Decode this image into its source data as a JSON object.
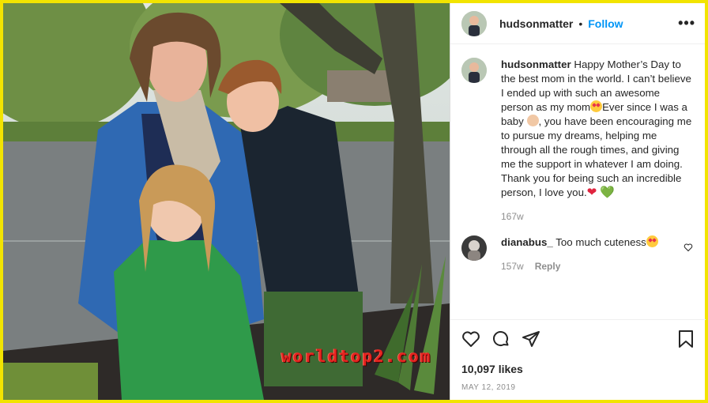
{
  "post": {
    "username": "hudsonmatter",
    "follow_label": "Follow",
    "separator": "•",
    "more_label": "•••",
    "caption": {
      "username": "hudsonmatter",
      "text_1": "Happy Mother’s Day to the best mom in the world. I can’t believe I ended up with such an awesome person as my mom",
      "emoji_1": "star-struck-emoji",
      "text_2": "Ever since I was a baby",
      "emoji_2": "baby-emoji",
      "text_3": ", you have been encouraging me to pursue my dreams, helping me through all the rough times, and giving me the support in whatever I am doing. Thank you for being such an incredible person, I love you.",
      "heart_red": "❤",
      "heart_green": "💚",
      "age": "167w"
    },
    "comment": {
      "username": "dianabus_",
      "text": "Too much cuteness",
      "emoji": "star-struck-emoji",
      "age": "157w",
      "reply_label": "Reply"
    },
    "likes": "10,097 likes",
    "date": "MAY 12, 2019"
  },
  "photo": {
    "watermark": "worldtop2.com"
  },
  "colors": {
    "frame": "#f2e400",
    "follow": "#0095f6",
    "watermark": "#e52420"
  }
}
